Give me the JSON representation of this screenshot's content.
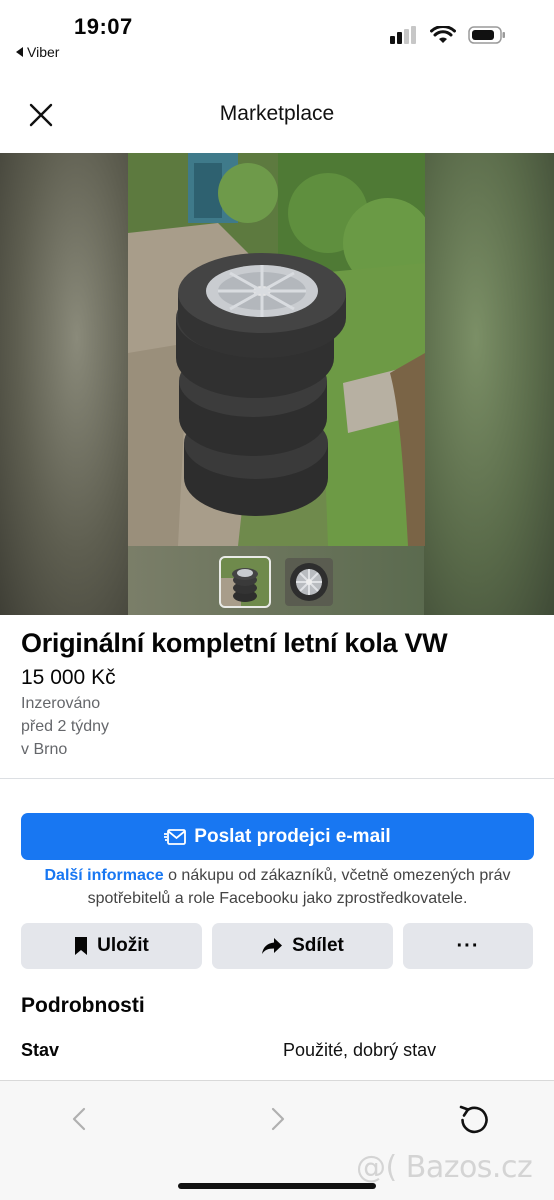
{
  "status_bar": {
    "time": "19:07",
    "back_app": "Viber"
  },
  "header": {
    "title": "Marketplace"
  },
  "listing": {
    "title": "Originální kompletní letní kola VW",
    "price": "15 000 Kč",
    "posted_label": "Inzerováno",
    "posted_time": "před 2 týdny",
    "location": "v Brno",
    "photo_count": 2
  },
  "actions": {
    "email_button": "Poslat prodejci e-mail",
    "info_link": "Další informace",
    "info_text": " o nákupu od zákazníků, včetně omezených práv spotřebitelů a role Facebooku jako zprostředkovatele.",
    "save_label": "Uložit",
    "share_label": "Sdílet",
    "more_label": "···"
  },
  "details": {
    "section_title": "Podrobnosti",
    "rows": [
      {
        "label": "Stav",
        "value": "Použité, dobrý stav"
      }
    ]
  },
  "watermark": "@( Bazos.cz",
  "colors": {
    "accent": "#1877f2",
    "button_gray": "#e4e6eb",
    "meta_text": "#65676b"
  },
  "icons": {
    "close": "close-icon",
    "mail": "mail-send-icon",
    "bookmark": "bookmark-icon",
    "share": "share-arrow-icon",
    "back": "chevron-left-icon",
    "forward": "chevron-right-icon",
    "reload": "reload-icon"
  }
}
